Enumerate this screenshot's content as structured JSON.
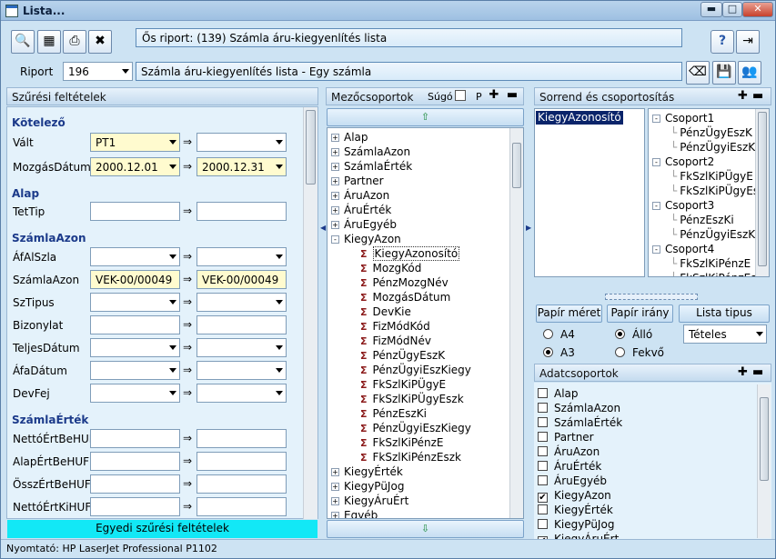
{
  "window": {
    "title": "Lista..."
  },
  "toolbar": {
    "info": "Ős riport: (139)  Számla áru-kiegyenlítés lista"
  },
  "report": {
    "label": "Riport",
    "id": "196",
    "name": "Számla áru-kiegyenlítés lista - Egy számla"
  },
  "filters": {
    "header": "Szűrési feltételek",
    "sections": [
      {
        "title": "Kötelező",
        "rows": [
          {
            "label": "Vált",
            "a": "PT1",
            "b": "",
            "a_yellow": true,
            "b_yellow": false,
            "dropdown": true
          },
          {
            "label": "MozgásDátum",
            "a": "2000.12.01",
            "b": "2000.12.31",
            "a_yellow": true,
            "b_yellow": true,
            "dropdown": true
          }
        ]
      },
      {
        "title": "Alap",
        "rows": [
          {
            "label": "TetTip",
            "a": "",
            "b": "",
            "dropdown": false
          }
        ]
      },
      {
        "title": "SzámlaAzon",
        "rows": [
          {
            "label": "ÁfAlSzla",
            "a": "",
            "b": "",
            "dropdown": true
          },
          {
            "label": "SzámlaAzon",
            "a": "VEK-00/00049",
            "b": "VEK-00/00049",
            "a_yellow": true,
            "b_yellow": true,
            "dropdown": false
          },
          {
            "label": "SzTipus",
            "a": "",
            "b": "",
            "dropdown": true
          },
          {
            "label": "Bizonylat",
            "a": "",
            "b": "",
            "dropdown": false
          },
          {
            "label": "TeljesDátum",
            "a": "",
            "b": "",
            "dropdown": true
          },
          {
            "label": "ÁfaDátum",
            "a": "",
            "b": "",
            "dropdown": true
          },
          {
            "label": "DevFej",
            "a": "",
            "b": "",
            "dropdown": true
          }
        ]
      },
      {
        "title": "SzámlaÉrték",
        "rows": [
          {
            "label": "NettóÉrtBeHUF",
            "a": "",
            "b": "",
            "dropdown": false
          },
          {
            "label": "AlapÉrtBeHUF",
            "a": "",
            "b": "",
            "dropdown": false
          },
          {
            "label": "ÖsszÉrtBeHUF",
            "a": "",
            "b": "",
            "dropdown": false
          },
          {
            "label": "NettóÉrtKiHUF",
            "a": "",
            "b": "",
            "dropdown": false
          }
        ]
      }
    ],
    "custom_button": "Egyedi szűrési feltételek"
  },
  "field_groups": {
    "header": "Mezőcsoportok",
    "help_label": "Súgó",
    "p_label": "P",
    "items": [
      {
        "label": "Alap",
        "expand": "+",
        "level": 0
      },
      {
        "label": "SzámlaAzon",
        "expand": "+",
        "level": 0
      },
      {
        "label": "SzámlaÉrték",
        "expand": "+",
        "level": 0
      },
      {
        "label": "Partner",
        "expand": "+",
        "level": 0
      },
      {
        "label": "ÁruAzon",
        "expand": "+",
        "level": 0
      },
      {
        "label": "ÁruÉrték",
        "expand": "+",
        "level": 0
      },
      {
        "label": "ÁruEgyéb",
        "expand": "+",
        "level": 0
      },
      {
        "label": "KiegyAzon",
        "expand": "-",
        "level": 0
      },
      {
        "label": "KiegyAzonosító",
        "level": 1,
        "selected": true
      },
      {
        "label": "MozgKód",
        "level": 1
      },
      {
        "label": "PénzMozgNév",
        "level": 1
      },
      {
        "label": "MozgásDátum",
        "level": 1
      },
      {
        "label": "DevKie",
        "level": 1
      },
      {
        "label": "FizMódKód",
        "level": 1
      },
      {
        "label": "FizMódNév",
        "level": 1
      },
      {
        "label": "PénzÜgyEszK",
        "level": 1
      },
      {
        "label": "PénzÜgyiEszKiegy",
        "level": 1
      },
      {
        "label": "FkSzlKiPÜgyE",
        "level": 1
      },
      {
        "label": "FkSzlKiPÜgyEszk",
        "level": 1
      },
      {
        "label": "PénzEszKi",
        "level": 1
      },
      {
        "label": "PénzÜgyiEszKiegy",
        "level": 1
      },
      {
        "label": "FkSzlKiPénzE",
        "level": 1
      },
      {
        "label": "FkSzlKiPénzEszk",
        "level": 1
      },
      {
        "label": "KiegyÉrték",
        "expand": "+",
        "level": 0
      },
      {
        "label": "KiegyPüJog",
        "expand": "+",
        "level": 0
      },
      {
        "label": "KiegyÁruÉrt",
        "expand": "+",
        "level": 0
      },
      {
        "label": "Egyéb",
        "expand": "+",
        "level": 0
      }
    ]
  },
  "sorting": {
    "header": "Sorrend és csoportosítás",
    "selected_field": "KiegyAzonosító",
    "groups": [
      {
        "label": "Csoport1",
        "level": 0
      },
      {
        "label": "PénzÜgyEszK",
        "level": 1
      },
      {
        "label": "PénzÜgyiEszKie",
        "level": 1
      },
      {
        "label": "Csoport2",
        "level": 0
      },
      {
        "label": "FkSzlKiPÜgyE",
        "level": 1
      },
      {
        "label": "FkSzlKiPÜgyEsz",
        "level": 1
      },
      {
        "label": "Csoport3",
        "level": 0
      },
      {
        "label": "PénzEszKi",
        "level": 1
      },
      {
        "label": "PénzÜgyiEszKie",
        "level": 1
      },
      {
        "label": "Csoport4",
        "level": 0
      },
      {
        "label": "FkSzlKiPénzE",
        "level": 1
      },
      {
        "label": "FkSzlKiPénzEsz",
        "level": 1
      }
    ]
  },
  "paper": {
    "size_label": "Papír méret",
    "orientation_label": "Papír irány",
    "list_type_label": "Lista tipus",
    "sizes": [
      "A4",
      "A3"
    ],
    "selected_size": "A3",
    "orientations": [
      "Álló",
      "Fekvő"
    ],
    "selected_orientation": "Álló",
    "list_type": "Tételes"
  },
  "data_groups": {
    "header": "Adatcsoportok",
    "items": [
      {
        "label": "Alap",
        "checked": false
      },
      {
        "label": "SzámlaAzon",
        "checked": false
      },
      {
        "label": "SzámlaÉrték",
        "checked": false
      },
      {
        "label": "Partner",
        "checked": false
      },
      {
        "label": "ÁruAzon",
        "checked": false
      },
      {
        "label": "ÁruÉrték",
        "checked": false
      },
      {
        "label": "ÁruEgyéb",
        "checked": false
      },
      {
        "label": "KiegyAzon",
        "checked": true
      },
      {
        "label": "KiegyÉrték",
        "checked": false
      },
      {
        "label": "KiegyPüJog",
        "checked": false
      },
      {
        "label": "KiegyÁruÉrt",
        "checked": true
      }
    ]
  },
  "status": {
    "printer": "Nyomtató: HP LaserJet Professional P1102"
  }
}
